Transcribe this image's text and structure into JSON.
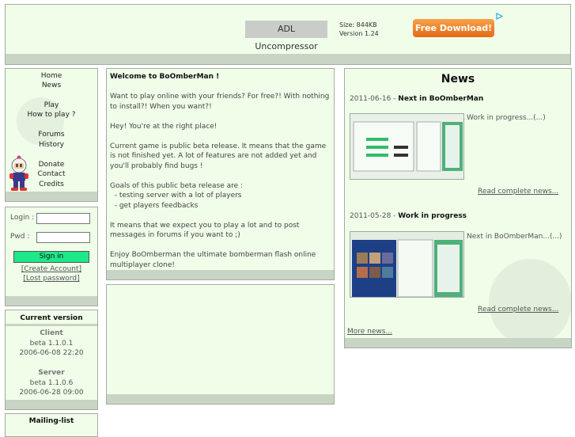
{
  "ad": {
    "product": "ADL Uncompressor",
    "size": "Size: 844KB",
    "version": "Version 1.24",
    "download": "Free Download!",
    "choices_icon": "ad-choices-triangle-icon"
  },
  "nav": {
    "items": [
      "Home",
      "News",
      "Play",
      "How to play ?",
      "Forums",
      "History",
      "Donate",
      "Contact",
      "Credits"
    ]
  },
  "login": {
    "login_label": "Login :",
    "pwd_label": "Pwd :",
    "signin": "Sign in",
    "create": "[Create Account]",
    "lost": "[Lost password]"
  },
  "version": {
    "title": "Current version",
    "client_label": "Client",
    "client_version": "beta 1.1.0.1",
    "client_date": "2006-06-08 22:20",
    "server_label": "Server",
    "server_version": "beta 1.1.0.6",
    "server_date": "2006-06-28 09:00"
  },
  "mailing": {
    "title": "Mailing-list"
  },
  "welcome": {
    "title": "Welcome to BoOmberMan !",
    "p1": "Want to play online with your friends? For free?! With nothing to install?! When you want?!",
    "p2": "Hey! You're at the right place!",
    "p3": "Current game is public beta release. It means that the game is not finished yet. A lot of features are not added yet and you'll probably find bugs !",
    "p4_head": "Goals of this public beta release are :",
    "p4_item1": "- testing server with a lot of players",
    "p4_item2": "- get players feedbacks",
    "p5": "It means that we expect you to play a lot and to post messages in forums if you want to ;)",
    "p6": "Enjoy BoOmberman the ultimate bomberman flash online multiplayer clone!"
  },
  "news": {
    "title": "News",
    "items": [
      {
        "date": "2011-06-16 -",
        "headline": "Next in BoOmberMan",
        "summary": "Work in progress...(...)",
        "read": "Read complete news..."
      },
      {
        "date": "2011-05-28 -",
        "headline": "Work in progress",
        "summary": "Next in BoOmberMan...(...)",
        "read": "Read complete news..."
      }
    ],
    "more": "More news..."
  }
}
